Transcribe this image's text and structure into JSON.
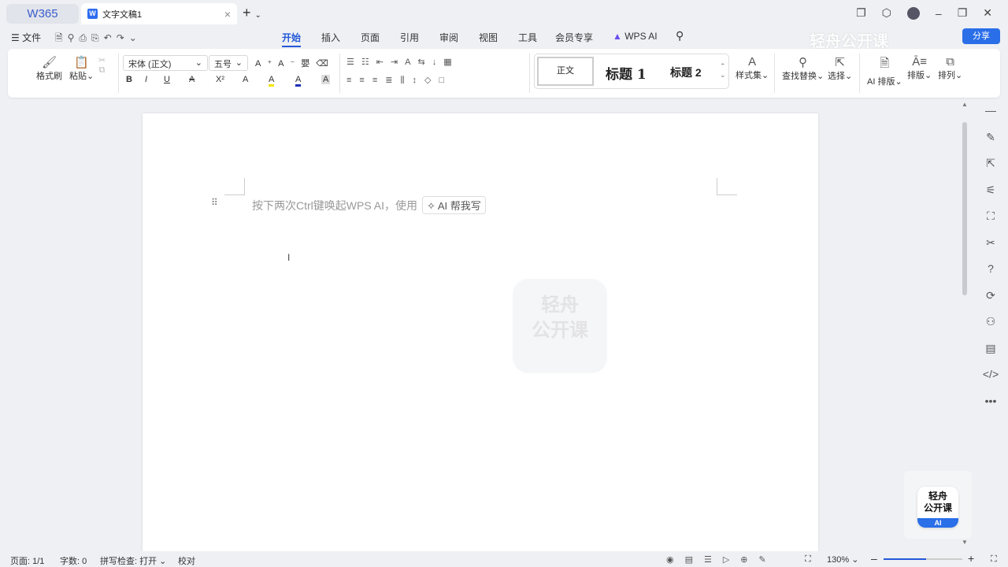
{
  "tabbar": {
    "home": "W365",
    "doc_tab": "文字文稿1",
    "doc_icon": "W"
  },
  "menu": {
    "file": "文件",
    "tabs": [
      "开始",
      "插入",
      "页面",
      "引用",
      "审阅",
      "视图",
      "工具",
      "会员专享",
      "WPS AI"
    ],
    "share": "分享"
  },
  "ribbon": {
    "format_painter": "格式刷",
    "paste": "粘贴",
    "font": "宋体 (正文)",
    "size": "五号",
    "bold": "B",
    "italic": "I",
    "underline": "U",
    "strike": "A",
    "superscript": "X²",
    "effect": "A",
    "highlight": "A",
    "color": "A",
    "shade": "A",
    "styles": [
      "正文",
      "标题 1",
      "标题 2"
    ],
    "style_set": "样式集",
    "find_replace": "查找替换",
    "select": "选择",
    "ai_layout": "AI 排版",
    "layout": "排版",
    "arrange": "排列",
    "font_color": "#1e2fb8",
    "highlight_color": "#f5e400"
  },
  "document": {
    "hint": "按下两次Ctrl键唤起WPS AI，使用",
    "ai_button": "AI 帮我写"
  },
  "watermark": {
    "text": "轻舟公开课",
    "badge": "AI"
  },
  "status": {
    "page": "页面: 1/1",
    "words": "字数: 0",
    "spell": "拼写检查: 打开",
    "proof": "校对",
    "zoom": "130%",
    "zoom_percent": 130
  }
}
